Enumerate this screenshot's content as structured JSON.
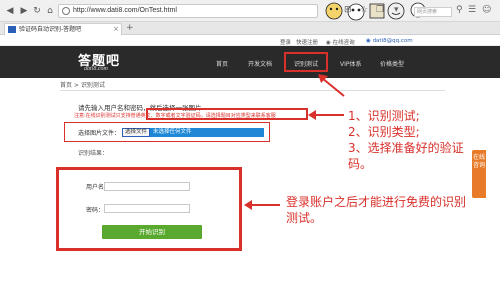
{
  "browser": {
    "back_icon": "back-arrow-icon",
    "forward_icon": "forward-arrow-icon",
    "reload_icon": "reload-icon",
    "home_icon": "home-icon",
    "url": "http://www.dati8.com/OnTest.html",
    "search_placeholder": "网页搜索",
    "tab_title": "验证码自动识别-答题吧",
    "new_tab": "+"
  },
  "topbar": {
    "login": "登录",
    "register": "快速注册",
    "online": "在线咨询",
    "user": "dati8@qq.com"
  },
  "header": {
    "logo": "答题吧",
    "logo_sub": "dati8.com",
    "nav": [
      "首页",
      "开发文档",
      "识别测试",
      "VIP体系",
      "价格类型"
    ]
  },
  "breadcrumb": "首页 > 识别测试",
  "upload": {
    "intro": "请先输入用户名和密码，然后选择一张图片",
    "note": "注意:在线识别测试只支持普通英文、数字或者文字验证码，请选择题目对应类型来联系客服",
    "label": "选择图片文件：",
    "choose_button": "选择文件",
    "file_placeholder": "未选择任何文件",
    "result_label": "识别结果："
  },
  "login": {
    "username_label": "用户名：",
    "password_label": "密码：",
    "submit": "开始识别"
  },
  "annotations": {
    "steps": [
      "1、识别测试;",
      "2、识别类型;",
      "3、选择准备好的验证",
      "码。"
    ],
    "bottom": [
      "登录账户之后才能进行免费的识别",
      "测试。"
    ]
  },
  "side_tab": "在线咨询",
  "colors": {
    "accent_red": "#d9302b",
    "header_bg": "#2a2a2a",
    "submit_green": "#5aa92f",
    "file_blue": "#1e88d6",
    "side_orange": "#e87b29"
  }
}
